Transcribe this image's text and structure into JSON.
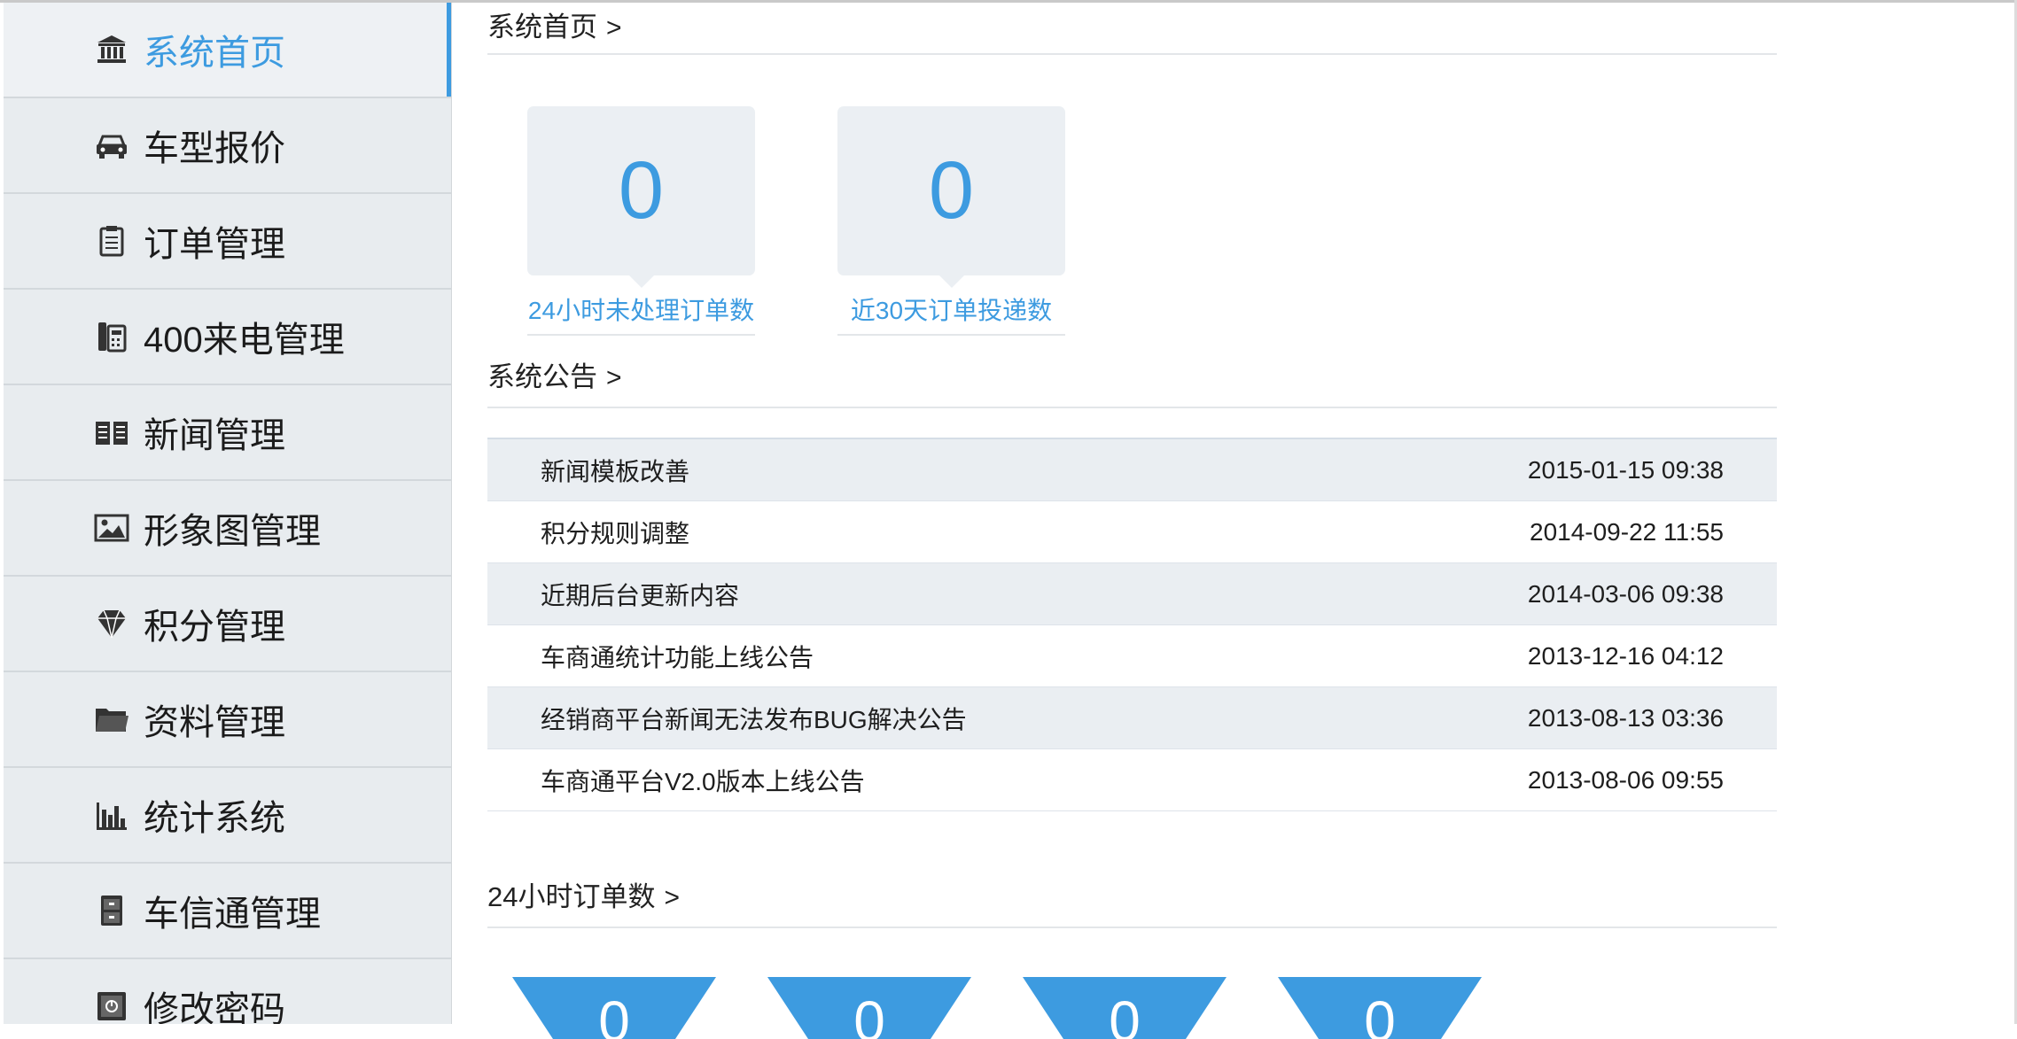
{
  "sidebar": {
    "items": [
      {
        "label": "系统首页",
        "icon": "bank-icon",
        "active": true
      },
      {
        "label": "车型报价",
        "icon": "car-icon"
      },
      {
        "label": "订单管理",
        "icon": "clipboard-icon"
      },
      {
        "label": "400来电管理",
        "icon": "phone-icon"
      },
      {
        "label": "新闻管理",
        "icon": "book-icon"
      },
      {
        "label": "形象图管理",
        "icon": "image-icon"
      },
      {
        "label": "积分管理",
        "icon": "diamond-icon"
      },
      {
        "label": "资料管理",
        "icon": "folder-icon"
      },
      {
        "label": "统计系统",
        "icon": "bar-chart-icon"
      },
      {
        "label": "车信通管理",
        "icon": "cabinet-icon"
      },
      {
        "label": "修改密码",
        "icon": "safe-icon"
      }
    ]
  },
  "main": {
    "home_title": "系统首页",
    "chevron": ">",
    "stats": [
      {
        "value": "0",
        "label": "24小时未处理订单数"
      },
      {
        "value": "0",
        "label": "近30天订单投递数"
      }
    ],
    "notice_title": "系统公告",
    "notices": [
      {
        "title": "新闻模板改善",
        "date": "2015-01-15 09:38"
      },
      {
        "title": "积分规则调整",
        "date": "2014-09-22 11:55"
      },
      {
        "title": "近期后台更新内容",
        "date": "2014-03-06 09:38"
      },
      {
        "title": "车商通统计功能上线公告",
        "date": "2013-12-16 04:12"
      },
      {
        "title": "经销商平台新闻无法发布BUG解决公告",
        "date": "2013-08-13 03:36"
      },
      {
        "title": "车商通平台V2.0版本上线公告",
        "date": "2013-08-06 09:55"
      }
    ],
    "orders_title": "24小时订单数",
    "order_counts": [
      "0",
      "0",
      "0",
      "0"
    ]
  },
  "colors": {
    "accent": "#3d9be0",
    "sidebar_bg": "#e8ecef",
    "card_bg": "#ebeff3"
  }
}
